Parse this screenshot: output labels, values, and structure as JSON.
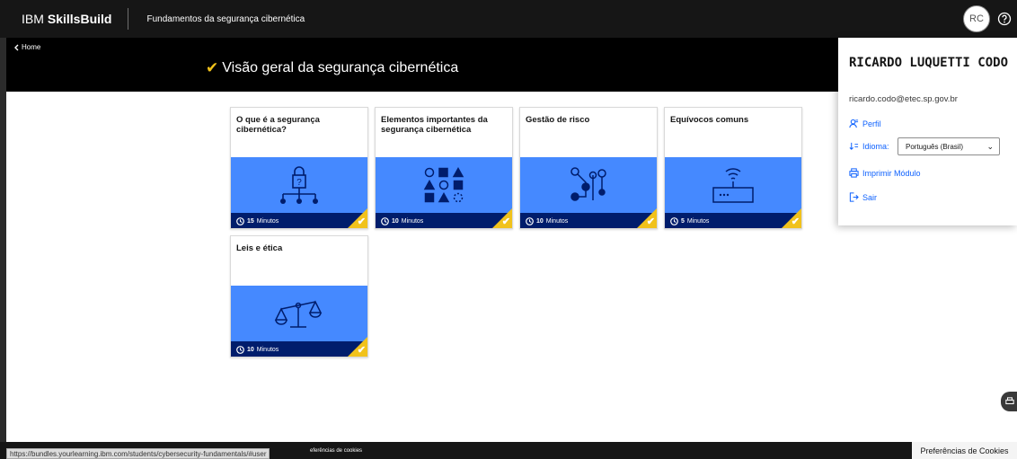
{
  "header": {
    "brand_ibm": "IBM",
    "brand_skillsbuild": "SkillsBuild",
    "course": "Fundamentos da segurança cibernética",
    "avatar_initials": "RC"
  },
  "module": {
    "home_label": "Home",
    "title": "Visão geral da segurança cibernética"
  },
  "cards": [
    {
      "title": "O que é a segurança cibernética?",
      "duration_num": "15",
      "duration_unit": "Minutos",
      "icon": "lock-network-icon"
    },
    {
      "title": "Elementos importantes da segurança cibernética",
      "duration_num": "10",
      "duration_unit": "Minutos",
      "icon": "shapes-grid-icon"
    },
    {
      "title": "Gestão de risco",
      "duration_num": "10",
      "duration_unit": "Minutos",
      "icon": "circuit-nodes-icon"
    },
    {
      "title": "Equívocos comuns",
      "duration_num": "5",
      "duration_unit": "Minutos",
      "icon": "wifi-router-icon"
    },
    {
      "title": "Leis e ética",
      "duration_num": "10",
      "duration_unit": "Minutos",
      "icon": "balance-scale-icon"
    }
  ],
  "profile": {
    "name": "RICARDO LUQUETTI CODO",
    "email": "ricardo.codo@etec.sp.gov.br",
    "profile_link": "Perfil",
    "language_label": "Idioma:",
    "language_value": "Português (Brasil)",
    "print_link": "Imprimir Módulo",
    "logout_link": "Sair"
  },
  "footer": {
    "status_url": "https://bundles.yourlearning.ibm.com/students/cybersecurity-fundamentals/#user",
    "cookies_small": "eferências de cookies",
    "cookies_button": "Preferências de Cookies"
  },
  "colors": {
    "accent_yellow": "#f1c21b",
    "card_blue": "#4589ff",
    "card_footer": "#001d6c",
    "link_blue": "#0f62fe"
  }
}
